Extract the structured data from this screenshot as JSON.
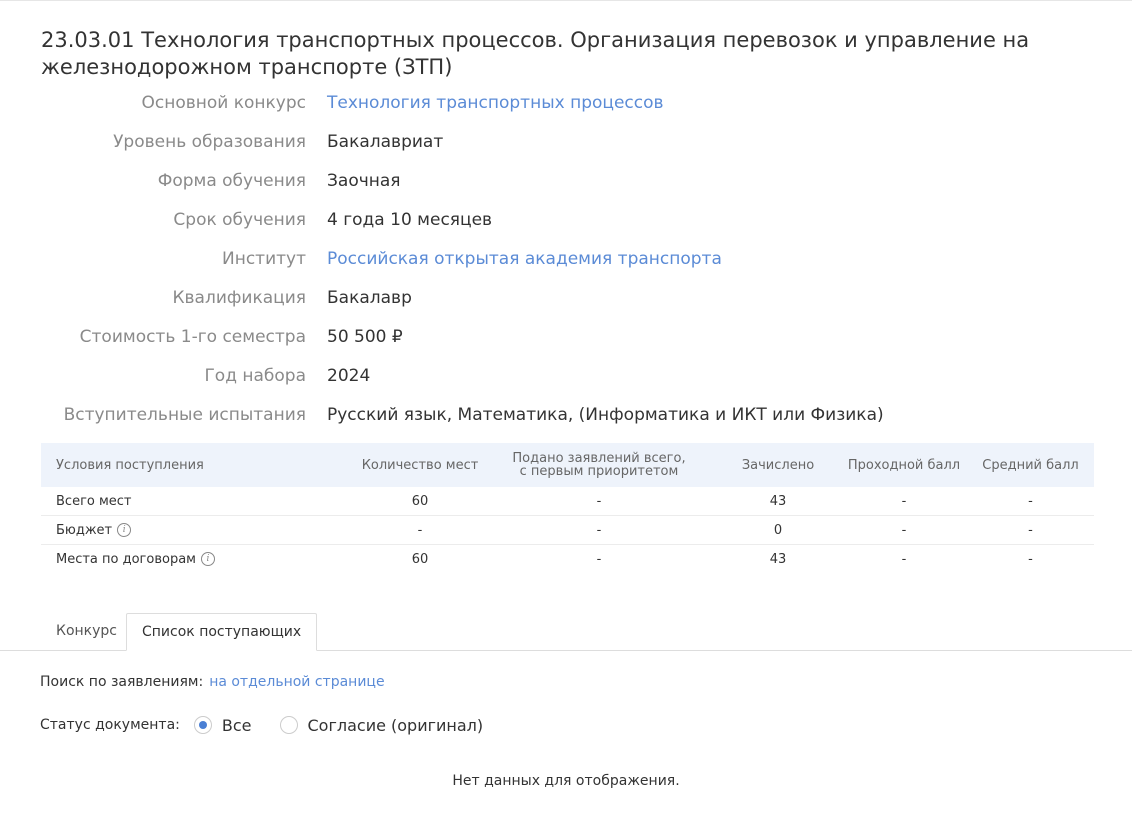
{
  "title": "23.03.01 Технология транспортных процессов. Организация перевозок и управление на железнодорожном транспорте (ЗТП)",
  "info": [
    {
      "label": "Основной конкурс",
      "value": "Технология транспортных процессов",
      "link": true
    },
    {
      "label": "Уровень образования",
      "value": "Бакалавриат",
      "link": false
    },
    {
      "label": "Форма обучения",
      "value": "Заочная",
      "link": false
    },
    {
      "label": "Срок обучения",
      "value": "4 года 10 месяцев",
      "link": false
    },
    {
      "label": "Институт",
      "value": "Российская открытая академия транспорта",
      "link": true
    },
    {
      "label": "Квалификация",
      "value": "Бакалавр",
      "link": false
    },
    {
      "label": "Стоимость 1-го семестра",
      "value": "50 500 ₽",
      "link": false
    },
    {
      "label": "Год набора",
      "value": "2024",
      "link": false
    },
    {
      "label": "Вступительные испытания",
      "value": "Русский язык, Математика, (Информатика и ИКТ или Физика)",
      "link": false
    }
  ],
  "stats": {
    "headers": {
      "conditions": "Условия поступления",
      "places": "Количество мест",
      "applied_line1": "Подано заявлений всего,",
      "applied_line2": "с первым приоритетом",
      "enrolled": "Зачислено",
      "passing": "Проходной балл",
      "average": "Средний балл"
    },
    "rows": [
      {
        "name": "Всего мест",
        "info": false,
        "places": "60",
        "applied": "-",
        "enrolled": "43",
        "passing": "-",
        "average": "-"
      },
      {
        "name": "Бюджет",
        "info": true,
        "places": "-",
        "applied": "-",
        "enrolled": "0",
        "passing": "-",
        "average": "-"
      },
      {
        "name": "Места по договорам",
        "info": true,
        "places": "60",
        "applied": "-",
        "enrolled": "43",
        "passing": "-",
        "average": "-"
      }
    ],
    "info_icon_glyph": "i"
  },
  "tabs": {
    "contest": "Конкурс",
    "applicants": "Список поступающих"
  },
  "search": {
    "label": "Поиск по заявлениям:",
    "link": "на отдельной странице"
  },
  "status": {
    "label": "Статус документа:",
    "options": [
      "Все",
      "Согласие (оригинал)"
    ],
    "selected_index": 0
  },
  "empty_message": "Нет данных для отображения.",
  "colors": {
    "link": "#5b8bd6",
    "header_bg": "#eef3fb",
    "radio_checked": "#4a7fd4"
  }
}
